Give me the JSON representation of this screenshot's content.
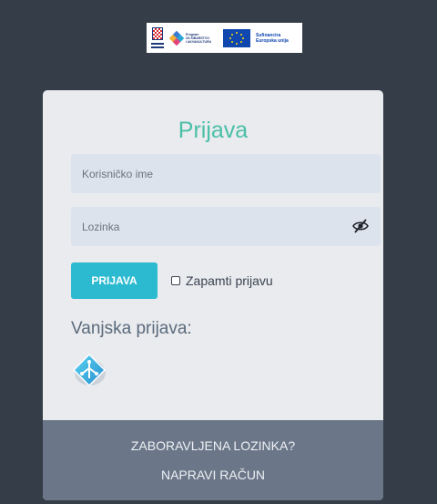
{
  "banner": {
    "program_text": [
      "Program",
      "ZA ŠIBARSTVO",
      "I AKVAKULTURU"
    ],
    "eu_text": [
      "Sufinancira",
      "Europska unija"
    ]
  },
  "login": {
    "title": "Prijava",
    "username_placeholder": "Korisničko ime",
    "password_placeholder": "Lozinka",
    "submit_label": "PRIJAVA",
    "remember_label": "Zapamti prijavu",
    "remember_checked": false,
    "external_label": "Vanjska prijava:",
    "external_provider_icon": "nias-icon"
  },
  "footer": {
    "forgot_password": "ZABORAVLJENA LOZINKA?",
    "register": "NAPRAVI RAČUN"
  },
  "colors": {
    "page_bg": "#343d48",
    "card_bg": "#e9ebee",
    "title": "#4bbfa8",
    "button": "#2bbad0",
    "footer_bg": "#6b7788"
  }
}
